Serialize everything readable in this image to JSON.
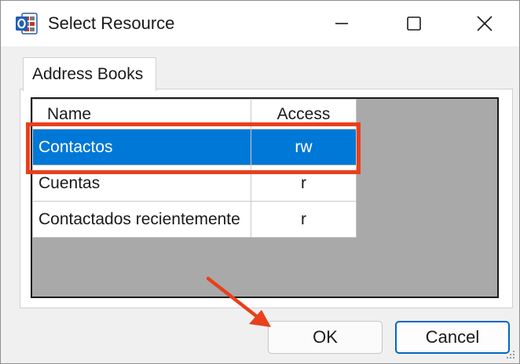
{
  "window": {
    "title": "Select Resource"
  },
  "tabs": [
    {
      "label": "Address Books"
    }
  ],
  "grid": {
    "columns": [
      "Name",
      "Access"
    ],
    "rows": [
      {
        "name": "Contactos",
        "access": "rw",
        "selected": true
      },
      {
        "name": "Cuentas",
        "access": "r",
        "selected": false
      },
      {
        "name": "Contactados recientemente",
        "access": "r",
        "selected": false
      }
    ]
  },
  "buttons": {
    "ok": "OK",
    "cancel": "Cancel"
  },
  "colors": {
    "selection": "#0078d7",
    "annotation": "#e8401c",
    "default_button_border": "#0067c0",
    "grid_background": "#a9a9a9"
  },
  "icons": {
    "app": "outlook-icon",
    "minimize": "minimize-icon",
    "maximize": "maximize-icon",
    "close": "close-icon"
  }
}
